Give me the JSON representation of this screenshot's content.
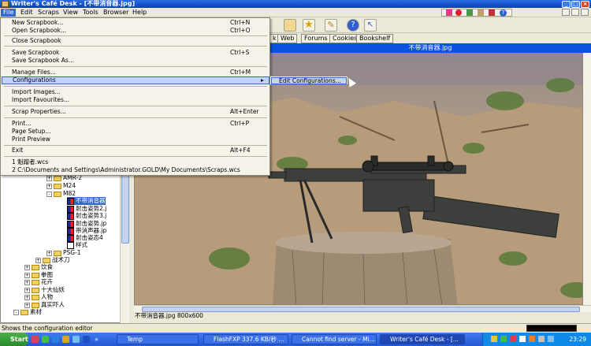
{
  "window": {
    "title": "Writer's Café Desk - [不带消音器.jpg]"
  },
  "menubar": [
    "File",
    "Edit",
    "Scraps",
    "View",
    "Tools",
    "Browser",
    "Help"
  ],
  "tabs": [
    "k",
    "Web",
    "Forums",
    "Cookies",
    "Bookshelf"
  ],
  "document_title": "不带消音器.jpg",
  "file_menu": [
    {
      "label": "New Scrapbook...",
      "shortcut": "Ctrl+N"
    },
    {
      "label": "Open Scrapbook...",
      "shortcut": "Ctrl+O"
    },
    {
      "label": "Close Scrapbook",
      "shortcut": ""
    },
    {
      "label": "Save Scrapbook",
      "shortcut": "Ctrl+S"
    },
    {
      "label": "Save Scrapbook As...",
      "shortcut": ""
    },
    {
      "label": "Manage Files...",
      "shortcut": "Ctrl+M"
    },
    {
      "label": "Configurations",
      "shortcut": ""
    },
    {
      "label": "Import Images...",
      "shortcut": ""
    },
    {
      "label": "Import Favourites...",
      "shortcut": ""
    },
    {
      "label": "Scrap Properties...",
      "shortcut": "Alt+Enter"
    },
    {
      "label": "Print...",
      "shortcut": "Ctrl+P"
    },
    {
      "label": "Page Setup...",
      "shortcut": ""
    },
    {
      "label": "Print Preview",
      "shortcut": ""
    },
    {
      "label": "Exit",
      "shortcut": "Alt+F4"
    },
    {
      "label": "1 魁蹭者.wcs",
      "shortcut": ""
    },
    {
      "label": "2 C:\\Documents and Settings\\Administrator.GOLD\\My Documents\\Scraps.wcs",
      "shortcut": ""
    }
  ],
  "submenu": {
    "label": "Edit Configurations..."
  },
  "tree": [
    {
      "label": "AMR-2",
      "kind": "folder",
      "expander": "+"
    },
    {
      "label": "M24",
      "kind": "folder",
      "expander": "+"
    },
    {
      "label": "M82",
      "kind": "folder",
      "expander": "-"
    },
    {
      "label": "不带消音器",
      "kind": "image",
      "selected": true
    },
    {
      "label": "射击姿势2.j",
      "kind": "image"
    },
    {
      "label": "射击姿势3.j",
      "kind": "image"
    },
    {
      "label": "射击姿势.jp",
      "kind": "image"
    },
    {
      "label": "带消声器.jp",
      "kind": "image"
    },
    {
      "label": "射击姿态4",
      "kind": "image"
    },
    {
      "label": "样式",
      "kind": "doc"
    },
    {
      "label": "PSG-1",
      "kind": "folder",
      "expander": "+"
    },
    {
      "label": "战术刀",
      "kind": "folder",
      "expander": "+"
    },
    {
      "label": "饮食",
      "kind": "folder",
      "expander": "+"
    },
    {
      "label": "拳图",
      "kind": "folder",
      "expander": "+"
    },
    {
      "label": "花卉",
      "kind": "folder",
      "expander": "+"
    },
    {
      "label": "十大仙妖",
      "kind": "folder",
      "expander": "+"
    },
    {
      "label": "人物",
      "kind": "folder",
      "expander": "+"
    },
    {
      "label": "真实吓人",
      "kind": "folder",
      "expander": "+"
    },
    {
      "label": "素材",
      "kind": "folder",
      "expander": "-"
    }
  ],
  "image_info": "不带消音器.jpg 800x600",
  "status": "Shows the configuration editor",
  "taskbar": {
    "start": "Start",
    "tasks": [
      "Temp",
      "FlashFXP 337.6 KB/秒 ...",
      "Cannot find server - Mi...",
      "Writer's Café Desk - [..."
    ],
    "clock": "23:29"
  }
}
